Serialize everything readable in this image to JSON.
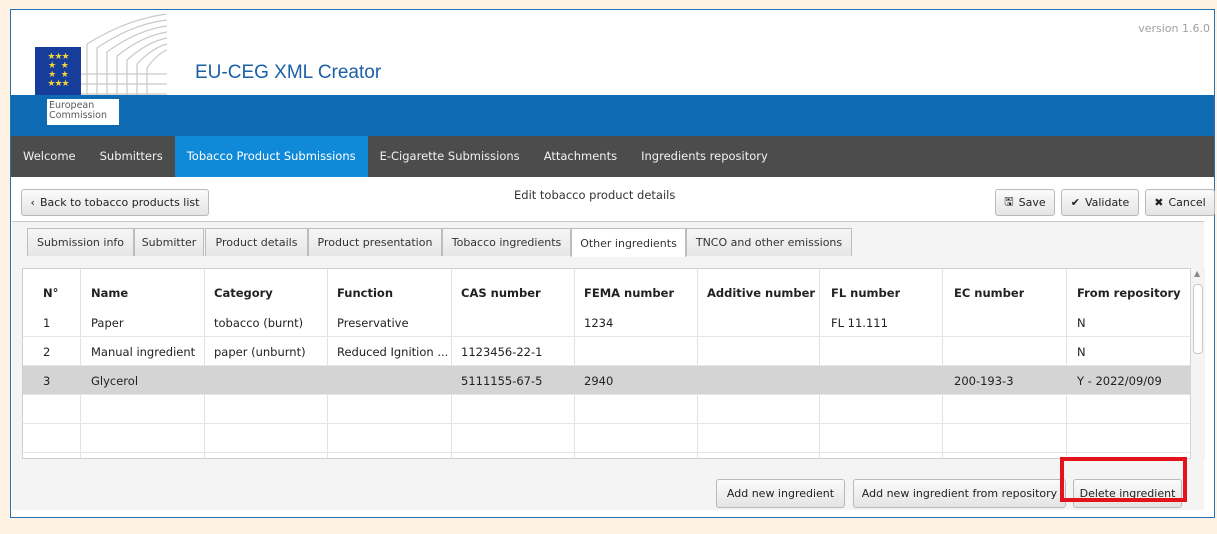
{
  "header": {
    "app_title": "EU-CEG XML Creator",
    "version": "version 1.6.0",
    "org_line1": "European",
    "org_line2": "Commission"
  },
  "nav": [
    {
      "label": "Welcome",
      "active": false
    },
    {
      "label": "Submitters",
      "active": false
    },
    {
      "label": "Tobacco Product Submissions",
      "active": true
    },
    {
      "label": "E-Cigarette Submissions",
      "active": false
    },
    {
      "label": "Attachments",
      "active": false
    },
    {
      "label": "Ingredients repository",
      "active": false
    }
  ],
  "toolbar": {
    "back_label": "Back to tobacco products list",
    "title": "Edit tobacco product details",
    "save_label": "Save",
    "validate_label": "Validate",
    "cancel_label": "Cancel"
  },
  "tabs": [
    {
      "label": "Submission info",
      "active": false
    },
    {
      "label": "Submitter",
      "active": false
    },
    {
      "label": "Product details",
      "active": false
    },
    {
      "label": "Product presentation",
      "active": false
    },
    {
      "label": "Tobacco ingredients",
      "active": false
    },
    {
      "label": "Other ingredients",
      "active": true
    },
    {
      "label": "TNCO and other emissions",
      "active": false
    }
  ],
  "table": {
    "columns": [
      "N°",
      "Name",
      "Category",
      "Function",
      "CAS number",
      "FEMA number",
      "Additive number",
      "FL number",
      "EC number",
      "From repository"
    ],
    "rows": [
      [
        "1",
        "Paper",
        "tobacco (burnt)",
        "Preservative",
        "",
        "1234",
        "",
        "FL 11.111",
        "",
        "N"
      ],
      [
        "2",
        "Manual ingredient",
        "paper (unburnt)",
        "Reduced Ignition ...",
        "1123456-22-1",
        "",
        "",
        "",
        "",
        "N"
      ],
      [
        "3",
        "Glycerol",
        "",
        "",
        "5111155-67-5",
        "2940",
        "",
        "",
        "200-193-3",
        "Y - 2022/09/09"
      ]
    ],
    "selected_row": 3
  },
  "actions": {
    "add_label": "Add new ingredient",
    "add_repo_label": "Add new ingredient from repository",
    "delete_label": "Delete ingredient"
  },
  "colors": {
    "accent_blue": "#0e6bb3",
    "nav_active": "#0f8ad9",
    "nav_bg": "#4c4c4c",
    "highlight": "#e3131b"
  }
}
